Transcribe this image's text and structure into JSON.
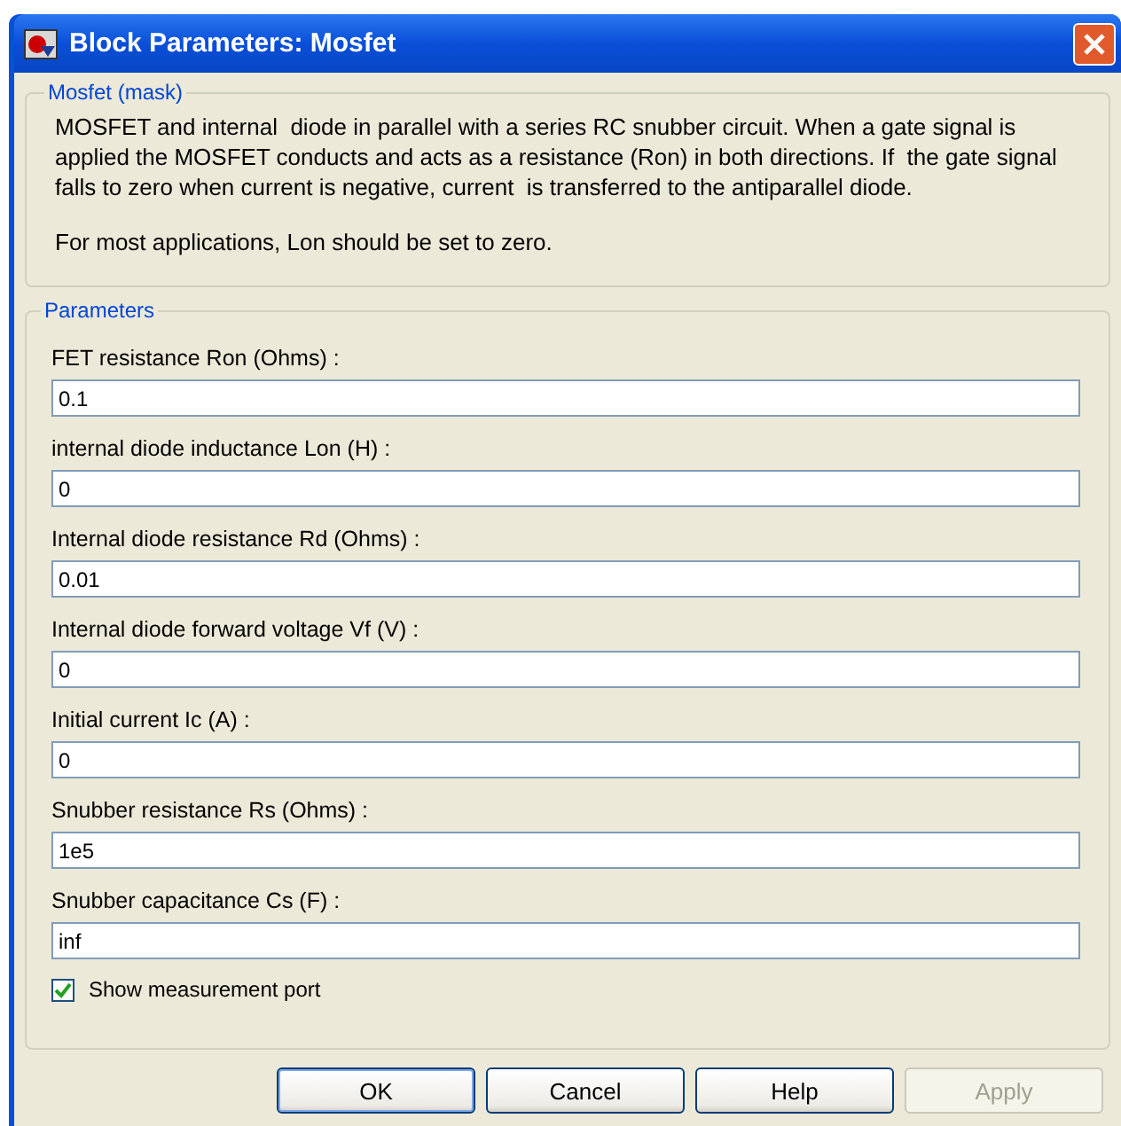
{
  "window": {
    "title": "Block Parameters: Mosfet"
  },
  "description": {
    "title": "Mosfet (mask)",
    "paragraphs": [
      "MOSFET and internal  diode in parallel with a series RC snubber circuit. When a gate signal is applied the MOSFET conducts and acts as a resistance (Ron) in both directions. If  the gate signal falls to zero when current is negative, current  is transferred to the antiparallel diode.",
      "For most applications, Lon should be set to zero."
    ]
  },
  "parameters": {
    "title": "Parameters",
    "fields": [
      {
        "label": "FET resistance Ron (Ohms) :",
        "value": "0.1"
      },
      {
        "label": "internal diode inductance Lon (H) :",
        "value": "0"
      },
      {
        "label": "Internal diode resistance Rd  (Ohms) :",
        "value": "0.01"
      },
      {
        "label": "Internal diode forward voltage Vf (V) :",
        "value": "0"
      },
      {
        "label": "Initial current Ic (A) :",
        "value": "0"
      },
      {
        "label": "Snubber resistance Rs (Ohms) :",
        "value": "1e5"
      },
      {
        "label": "Snubber capacitance Cs (F) :",
        "value": "inf"
      }
    ],
    "checkbox": {
      "label": "Show measurement port",
      "checked": true
    }
  },
  "buttons": [
    {
      "label": "OK",
      "default": true,
      "disabled": false
    },
    {
      "label": "Cancel",
      "default": false,
      "disabled": false
    },
    {
      "label": "Help",
      "default": false,
      "disabled": false
    },
    {
      "label": "Apply",
      "default": false,
      "disabled": true
    }
  ]
}
